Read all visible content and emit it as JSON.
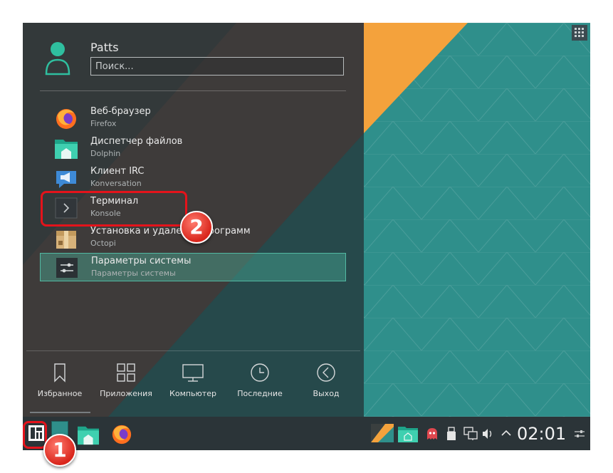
{
  "user": {
    "name": "Patts"
  },
  "search": {
    "placeholder": "Поиск..."
  },
  "menu_items": [
    {
      "title": "Веб-браузер",
      "subtitle": "Firefox",
      "icon": "firefox-icon"
    },
    {
      "title": "Диспетчер файлов",
      "subtitle": "Dolphin",
      "icon": "folder-icon"
    },
    {
      "title": "Клиент IRC",
      "subtitle": "Konversation",
      "icon": "megaphone-icon"
    },
    {
      "title": "Терминал",
      "subtitle": "Konsole",
      "icon": "terminal-icon"
    },
    {
      "title": "Установка и удаление программ",
      "subtitle": "Octopi",
      "icon": "package-box-icon"
    },
    {
      "title": "Параметры системы",
      "subtitle": "Параметры системы",
      "icon": "settings-sliders-icon"
    }
  ],
  "bottom_nav": [
    {
      "label": "Избранное",
      "icon": "bookmark-icon"
    },
    {
      "label": "Приложения",
      "icon": "grid-icon"
    },
    {
      "label": "Компьютер",
      "icon": "monitor-icon"
    },
    {
      "label": "Последние",
      "icon": "clock-icon"
    },
    {
      "label": "Выход",
      "icon": "back-circle-icon"
    }
  ],
  "taskbar": {
    "clock": "02:01"
  },
  "annotations": {
    "marker1": "1",
    "marker2": "2"
  },
  "colors": {
    "accent": "#52b9a2",
    "highlight": "#e4131b",
    "taskbar": "#2b3438",
    "wallpaper": "#2f8f8b"
  }
}
